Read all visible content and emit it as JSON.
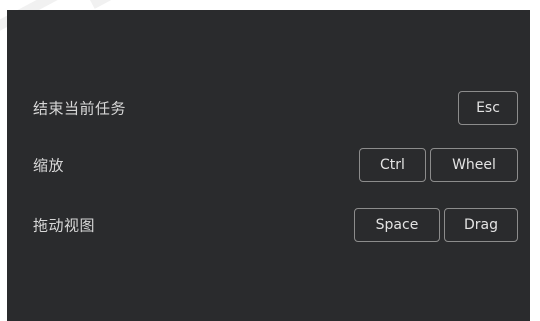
{
  "shortcuts": [
    {
      "label": "结束当前任务",
      "keys": [
        "Esc"
      ]
    },
    {
      "label": "缩放",
      "keys": [
        "Ctrl",
        "Wheel"
      ]
    },
    {
      "label": "拖动视图",
      "keys": [
        "Space",
        "Drag"
      ]
    }
  ],
  "colors": {
    "panel_background": "#2a2b2d",
    "text": "#d7d7d7",
    "key_border": "#8c8c8c"
  }
}
